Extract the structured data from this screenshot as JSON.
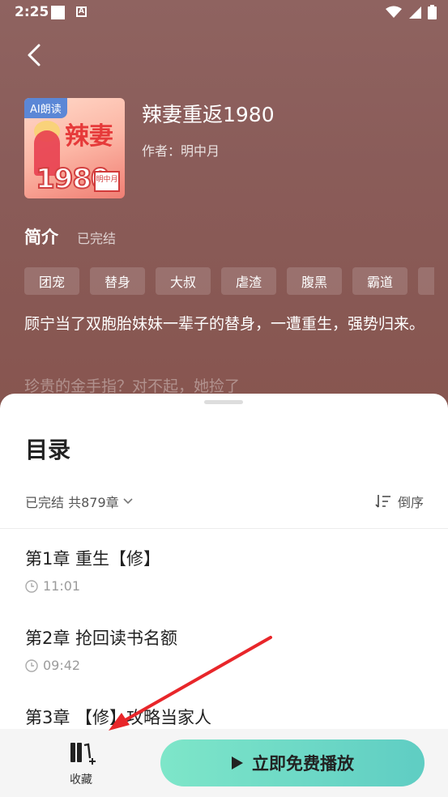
{
  "status_bar": {
    "time": "2:25",
    "a_icon": "A"
  },
  "book": {
    "badge": "AI朗读",
    "title": "辣妻重返1980",
    "author": "作者：明中月",
    "cover_text_1": "辣妻",
    "cover_text_2": "1980",
    "cover_seal": "明中月"
  },
  "intro": {
    "heading": "简介",
    "status": "已完结",
    "tags": [
      "团宠",
      "替身",
      "大叔",
      "虐渣",
      "腹黑",
      "霸道"
    ],
    "description": "顾宁当了双胞胎妹妹一辈子的替身，一遭重生，强势归来。",
    "description_faded": "珍贵的金手指？对不起，她捡了"
  },
  "toc": {
    "heading": "目录",
    "summary": "已完结 共879章",
    "sort_label": "倒序",
    "chapters": [
      {
        "title": "第1章  重生【修】",
        "time": "11:01"
      },
      {
        "title": "第2章  抢回读书名额",
        "time": "09:42"
      },
      {
        "title": "第3章  【修】攻略当家人",
        "time": ""
      }
    ]
  },
  "bottom": {
    "favorite_label": "收藏",
    "play_label": "立即免费播放"
  },
  "colors": {
    "hero_bg": "#8e5f5c",
    "play_gradient_start": "#7ee6c9",
    "play_gradient_end": "#5fcdc3",
    "arrow": "#e8262a"
  }
}
